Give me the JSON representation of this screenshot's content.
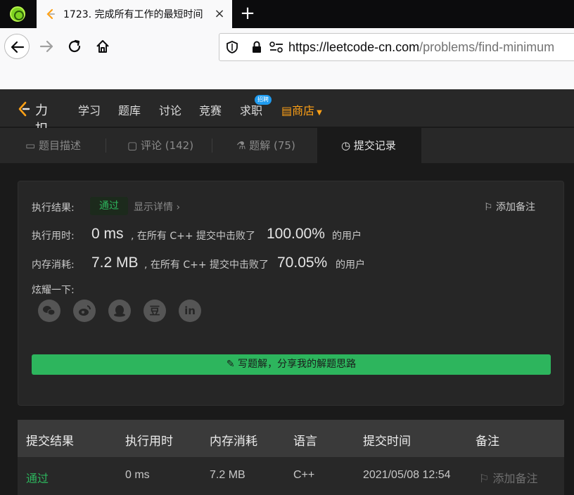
{
  "browser": {
    "tab_title": "1723. 完成所有工作的最短时间",
    "url_domain": "https://leetcode-cn.com",
    "url_path": "/problems/find-minimum",
    "close_symbol": "×",
    "new_tab_symbol": "+"
  },
  "site_nav": {
    "logo_text": "力扣",
    "items": [
      "学习",
      "题库",
      "讨论",
      "竞赛",
      "求职"
    ],
    "badge": "招聘",
    "shop": "商店"
  },
  "problem_tabs": [
    {
      "label": "题目描述"
    },
    {
      "label": "评论 (142)"
    },
    {
      "label": "题解 (75)"
    },
    {
      "label": "提交记录"
    }
  ],
  "result": {
    "status_label": "执行结果:",
    "status": "通过",
    "detail_link": "显示详情 ›",
    "add_note": "添加备注",
    "runtime_label": "执行用时:",
    "runtime": "0 ms",
    "runtime_text": ", 在所有 C++ 提交中击败了",
    "runtime_pct": "100.00%",
    "users_text": "的用户",
    "memory_label": "内存消耗:",
    "memory": "7.2 MB",
    "memory_text": ", 在所有 C++ 提交中击败了",
    "memory_pct": "70.05%",
    "share_label": "炫耀一下:",
    "share_icons": [
      "wechat-icon",
      "weibo-icon",
      "qq-icon",
      "douban-icon",
      "linkedin-icon"
    ],
    "douban_glyph": "豆",
    "linkedin_glyph": "in",
    "write_solution": "写题解，分享我的解题思路"
  },
  "submissions": {
    "headers": [
      "提交结果",
      "执行用时",
      "内存消耗",
      "语言",
      "提交时间",
      "备注"
    ],
    "rows": [
      {
        "result": "通过",
        "runtime": "0 ms",
        "memory": "7.2 MB",
        "lang": "C++",
        "time": "2021/05/08 12:54",
        "note": "添加备注"
      }
    ]
  },
  "colors": {
    "accent_green": "#2db55d",
    "shop_orange": "#ffa116",
    "badge_blue": "#1f9bef"
  }
}
